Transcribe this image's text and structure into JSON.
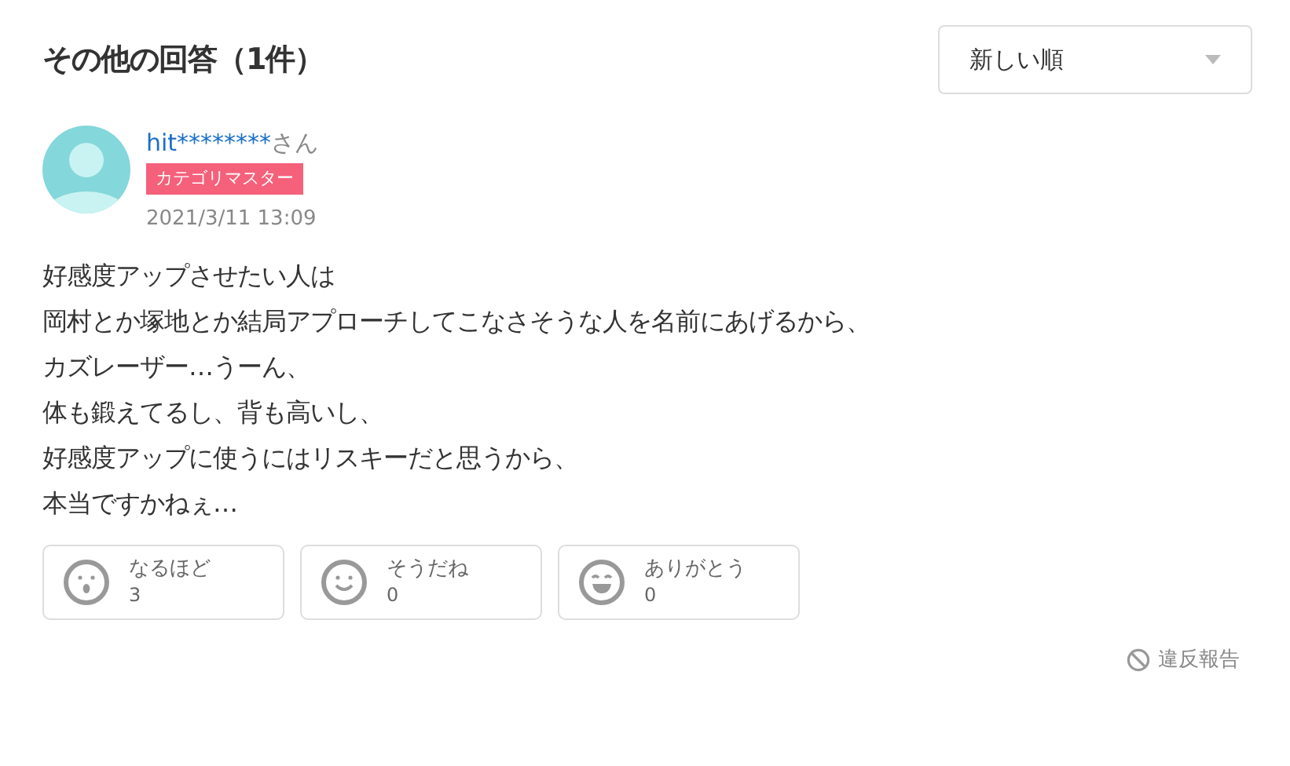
{
  "header": {
    "title": "その他の回答（1件）",
    "sort": {
      "value": "新しい順"
    }
  },
  "answer": {
    "user": {
      "name": "hit********",
      "suffix": "さん",
      "badge": "カテゴリマスター",
      "date": "2021/3/11 13:09"
    },
    "body": [
      "好感度アップさせたい人は",
      "岡村とか塚地とか結局アプローチしてこなさそうな人を名前にあげるから、",
      "カズレーザー…うーん、",
      "体も鍛えてるし、背も高いし、",
      "好感度アップに使うにはリスキーだと思うから、",
      "本当ですかねぇ…"
    ],
    "reactions": [
      {
        "kind": "surprised",
        "label": "なるほど",
        "count": "3"
      },
      {
        "kind": "smile",
        "label": "そうだね",
        "count": "0"
      },
      {
        "kind": "laugh",
        "label": "ありがとう",
        "count": "0"
      }
    ],
    "report": "違反報告"
  }
}
